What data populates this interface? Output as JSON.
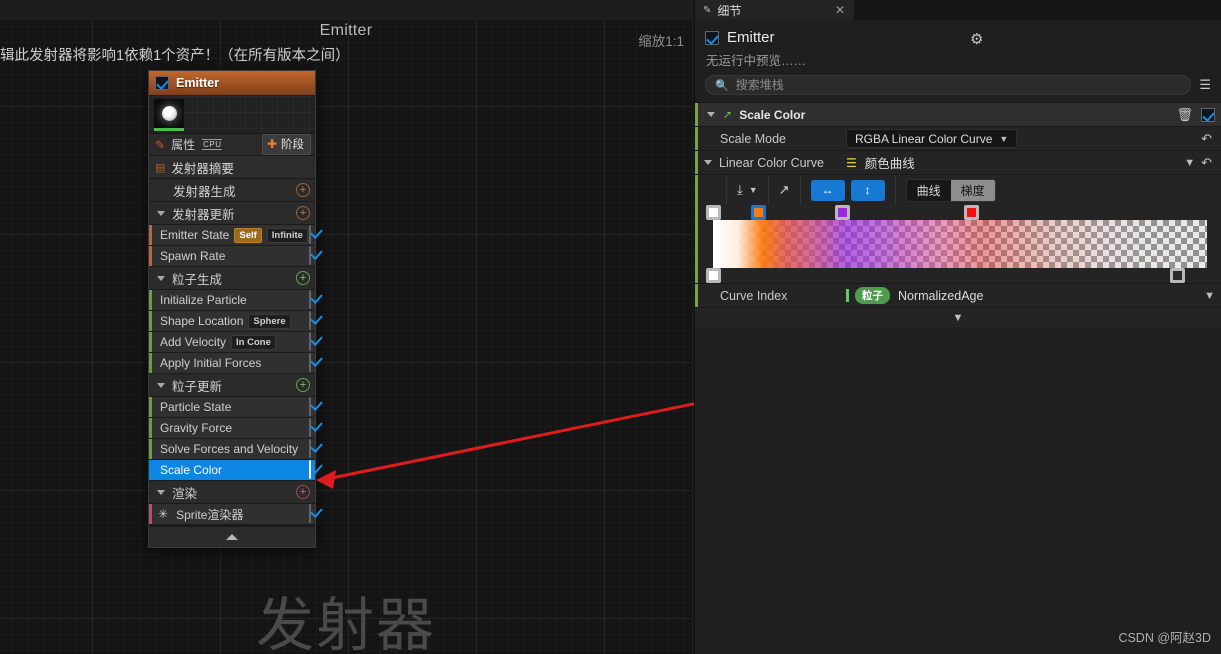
{
  "graph": {
    "window_strip_title": "Emitter",
    "zoom_label": "缩放1:1",
    "warning_text": "辑此发射器将影响1依赖1个资产！（在所有版本之间）",
    "watermark": "发射器"
  },
  "node": {
    "title": "Emitter",
    "checkbox_checked": true,
    "property_row": {
      "label": "属性",
      "cpu_badge": "CPU",
      "stage_button": "阶段",
      "plus": "✚"
    },
    "summary_row": {
      "label": "发射器摘要"
    },
    "groups": [
      {
        "id": "emitter_spawn",
        "label": "发射器生成",
        "expanded": false,
        "accent": "orange"
      },
      {
        "id": "emitter_update",
        "label": "发射器更新",
        "expanded": true,
        "accent": "orange"
      },
      {
        "id": "particle_spawn",
        "label": "粒子生成",
        "expanded": true,
        "accent": "green"
      },
      {
        "id": "particle_update",
        "label": "粒子更新",
        "expanded": true,
        "accent": "green"
      },
      {
        "id": "render",
        "label": "渲染",
        "expanded": true,
        "accent": "pink"
      }
    ],
    "modules": [
      {
        "group": "emitter_update",
        "label": "Emitter State",
        "pills": [
          "Self",
          "Infinite"
        ],
        "checked": true,
        "selected": false,
        "stripe": "#b0674a"
      },
      {
        "group": "emitter_update",
        "label": "Spawn Rate",
        "pills": [],
        "checked": true,
        "selected": false,
        "stripe": "#b0674a"
      },
      {
        "group": "particle_spawn",
        "label": "Initialize Particle",
        "pills": [],
        "checked": true,
        "selected": false,
        "stripe": "#6f9a4c"
      },
      {
        "group": "particle_spawn",
        "label": "Shape Location",
        "pills": [
          "Sphere"
        ],
        "checked": true,
        "selected": false,
        "stripe": "#6f9a4c"
      },
      {
        "group": "particle_spawn",
        "label": "Add Velocity",
        "pills": [
          "In Cone"
        ],
        "checked": true,
        "selected": false,
        "stripe": "#6f9a4c"
      },
      {
        "group": "particle_spawn",
        "label": "Apply Initial Forces",
        "pills": [],
        "checked": true,
        "selected": false,
        "stripe": "#6f9a4c"
      },
      {
        "group": "particle_update",
        "label": "Particle State",
        "pills": [],
        "checked": true,
        "selected": false,
        "stripe": "#6f9a4c"
      },
      {
        "group": "particle_update",
        "label": "Gravity Force",
        "pills": [],
        "checked": true,
        "selected": false,
        "stripe": "#6f9a4c"
      },
      {
        "group": "particle_update",
        "label": "Solve Forces and Velocity",
        "pills": [],
        "checked": true,
        "selected": false,
        "stripe": "#6f9a4c"
      },
      {
        "group": "particle_update",
        "label": "Scale Color",
        "pills": [],
        "checked": true,
        "selected": true,
        "stripe": "#0b86e4"
      },
      {
        "group": "render",
        "label": "Sprite渲染器",
        "pills": [],
        "checked": true,
        "selected": false,
        "stripe": "#b0546a",
        "icon": "sprite-star-icon"
      }
    ],
    "footer_collapse": "collapse-chevron-icon"
  },
  "details": {
    "tab": {
      "label": "细节",
      "icon": "details-pencil-icon",
      "close": "✕"
    },
    "header": {
      "title": "Emitter",
      "checked": true,
      "subtitle": "无运行中预览……",
      "gear": "gear-icon"
    },
    "search": {
      "placeholder": "搜索堆栈",
      "value": ""
    },
    "section": {
      "title": "Scale Color",
      "enabled": true,
      "expanded": true,
      "trash": "trash-icon",
      "rows": {
        "scale_mode": {
          "label": "Scale Mode",
          "value": "RGBA Linear Color Curve"
        },
        "linear_color_curve": {
          "label": "Linear Color Curve",
          "value": "颜色曲线"
        },
        "curve_index": {
          "label": "Curve Index",
          "tag": "粒子",
          "value": "NormalizedAge"
        }
      }
    },
    "curve_toolbar": {
      "import_export": "import-icon",
      "external": "external-link-icon",
      "fit_horizontal": "fit-horizontal-icon",
      "fit_vertical": "fit-vertical-icon",
      "mode_curve": "曲线",
      "mode_gradient": "梯度",
      "mode_active": "梯度"
    },
    "gradient": {
      "color_stops": [
        {
          "position": 0.0,
          "color": "#ffffff",
          "selected": false
        },
        {
          "position": 0.095,
          "color": "#ff7a0a",
          "selected": true
        },
        {
          "position": 0.275,
          "color": "#9b2ae0",
          "selected": false
        },
        {
          "position": 0.555,
          "color": "#ee1111",
          "selected": false
        }
      ],
      "alpha_stops": [
        {
          "position": 0.0,
          "alpha": 1.0
        },
        {
          "position": 1.0,
          "alpha": 0.0
        }
      ]
    },
    "expand_more": "expand-chevron-icon"
  },
  "watermark_credit": "CSDN @阿赵3D",
  "colors": {
    "accent_blue": "#0b86e4",
    "node_header_orange": "#9e5124",
    "green_stripe": "#7aa24f",
    "arrow_red": "#e01b1b"
  }
}
